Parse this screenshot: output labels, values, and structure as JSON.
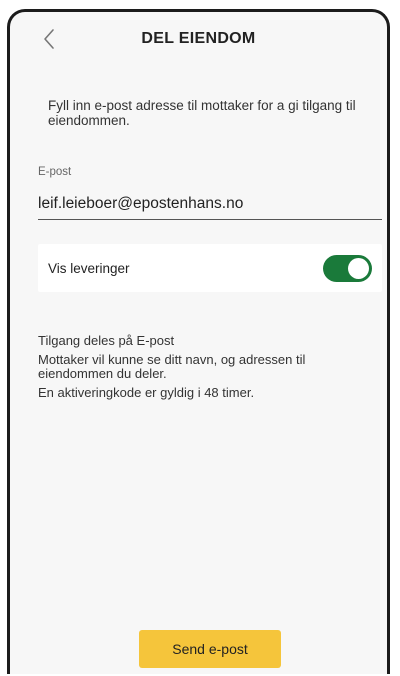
{
  "header": {
    "title": "DEL EIENDOM",
    "back_icon": "chevron-left-icon"
  },
  "intro_text": "Fyll inn e-post adresse til mottaker for a gi tilgang til eiendommen.",
  "email": {
    "label": "E-post",
    "value": "leif.leieboer@epostenhans.no"
  },
  "toggle": {
    "label": "Vis leveringer",
    "on": true,
    "color": "#1a7a3a"
  },
  "info": {
    "line1": "Tilgang deles på E-post",
    "line2": "Mottaker vil kunne se ditt navn, og adressen til eiendommen du deler.",
    "line3": "En aktiveringkode er gyldig i 48 timer."
  },
  "send_button": {
    "label": "Send e-post",
    "color": "#f5c53b"
  }
}
